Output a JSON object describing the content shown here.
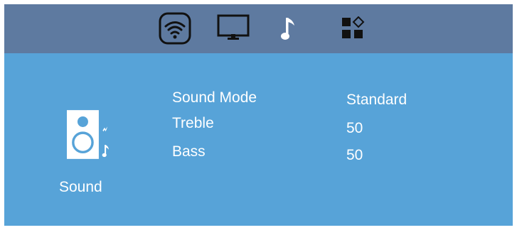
{
  "topbar": {
    "tabs": [
      {
        "id": "wifi",
        "icon": "wifi-icon",
        "selected": true
      },
      {
        "id": "display",
        "icon": "monitor-icon",
        "selected": false
      },
      {
        "id": "sound",
        "icon": "music-note-icon",
        "selected": false
      },
      {
        "id": "apps",
        "icon": "apps-grid-icon",
        "selected": false
      }
    ]
  },
  "sound_panel": {
    "icon": "speaker-icon",
    "label": "Sound",
    "settings": [
      {
        "label": "Sound Mode",
        "value": "Standard"
      },
      {
        "label": "Treble",
        "value": "50"
      },
      {
        "label": "Bass",
        "value": "50"
      }
    ]
  },
  "colors": {
    "background": "#57a3d8",
    "topbar": "#5e7aa0",
    "foreground": "#ffffff"
  }
}
